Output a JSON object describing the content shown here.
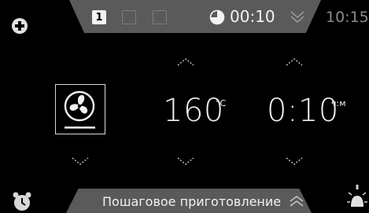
{
  "top_bar": {
    "steps": [
      "1",
      "",
      ""
    ],
    "timer_value": "00:10",
    "clock": "10:15"
  },
  "main": {
    "temperature": {
      "value": "160",
      "unit": "°C"
    },
    "duration": {
      "value": "0:10",
      "unit": "ч:м"
    }
  },
  "bottom_bar": {
    "label": "Пошаговое приготовление"
  }
}
